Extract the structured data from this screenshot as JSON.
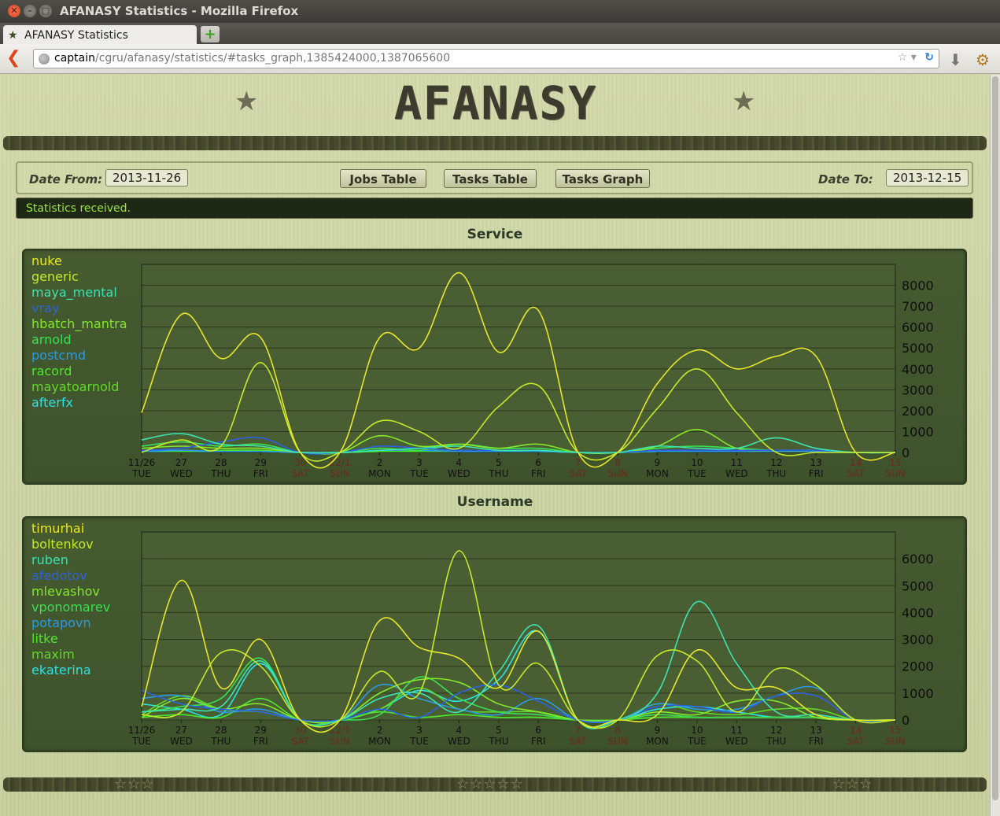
{
  "window": {
    "title": "AFANASY Statistics - Mozilla Firefox"
  },
  "tab": {
    "label": "AFANASY Statistics",
    "new_tab_symbol": "+"
  },
  "url": {
    "host": "captain",
    "path": "/cgru/afanasy/statistics/#tasks_graph,1385424000,1387065600"
  },
  "header": {
    "logo": "AFANASY"
  },
  "controls": {
    "date_from_label": "Date From:",
    "date_from_value": "2013-11-26",
    "date_to_label": "Date To:",
    "date_to_value": "2013-12-15",
    "jobs_table": "Jobs Table",
    "tasks_table": "Tasks Table",
    "tasks_graph": "Tasks Graph"
  },
  "status": "Statistics received.",
  "colors": {
    "weekday_label": "#111111",
    "weekend_label": "#6b2a1a",
    "grid": "#2a361d",
    "plot_bg": "#4a5e34"
  },
  "chart_data": [
    {
      "type": "line",
      "title": "Service",
      "x": [
        "11/26",
        "27",
        "28",
        "29",
        "30",
        "12/1",
        "2",
        "3",
        "4",
        "5",
        "6",
        "7",
        "8",
        "9",
        "10",
        "11",
        "12",
        "13",
        "14",
        "15"
      ],
      "x_days": [
        "TUE",
        "WED",
        "THU",
        "FRI",
        "SAT",
        "SUN",
        "MON",
        "TUE",
        "WED",
        "THU",
        "FRI",
        "SAT",
        "SUN",
        "MON",
        "TUE",
        "WED",
        "THU",
        "FRI",
        "SAT",
        "SUN"
      ],
      "weekend": [
        false,
        false,
        false,
        false,
        true,
        true,
        false,
        false,
        false,
        false,
        false,
        true,
        true,
        false,
        false,
        false,
        false,
        false,
        true,
        true
      ],
      "ylim": [
        0,
        9000
      ],
      "yticks": [
        0,
        1000,
        2000,
        3000,
        4000,
        5000,
        6000,
        7000,
        8000
      ],
      "series": [
        {
          "name": "nuke",
          "color": "#e6e62a",
          "values": [
            1900,
            6600,
            4500,
            5500,
            0,
            0,
            5500,
            5000,
            8600,
            4800,
            6800,
            0,
            0,
            3300,
            4900,
            4000,
            4600,
            4600,
            0,
            0
          ]
        },
        {
          "name": "generic",
          "color": "#c4e82a",
          "values": [
            0,
            600,
            300,
            4300,
            0,
            0,
            1500,
            1000,
            200,
            2200,
            3200,
            0,
            0,
            2100,
            4000,
            1900,
            0,
            0,
            0,
            0
          ]
        },
        {
          "name": "maya_mental",
          "color": "#3ce3b0",
          "values": [
            600,
            900,
            400,
            300,
            0,
            0,
            100,
            200,
            300,
            100,
            100,
            0,
            0,
            300,
            200,
            200,
            700,
            200,
            0,
            0
          ]
        },
        {
          "name": "vray",
          "color": "#2a62e3",
          "values": [
            100,
            200,
            500,
            700,
            0,
            0,
            300,
            200,
            100,
            100,
            100,
            0,
            0,
            100,
            100,
            100,
            100,
            100,
            0,
            0
          ]
        },
        {
          "name": "hbatch_mantra",
          "color": "#82e82a",
          "values": [
            200,
            300,
            200,
            200,
            0,
            0,
            800,
            300,
            400,
            200,
            400,
            0,
            0,
            300,
            1100,
            200,
            100,
            100,
            0,
            0
          ]
        },
        {
          "name": "arnold",
          "color": "#3ae052",
          "values": [
            300,
            500,
            300,
            400,
            0,
            0,
            200,
            100,
            400,
            200,
            200,
            0,
            0,
            200,
            300,
            200,
            100,
            100,
            0,
            0
          ]
        },
        {
          "name": "postcmd",
          "color": "#2a9ae3",
          "values": [
            50,
            100,
            50,
            50,
            0,
            0,
            100,
            100,
            50,
            50,
            50,
            0,
            0,
            50,
            50,
            50,
            50,
            50,
            0,
            0
          ]
        },
        {
          "name": "racord",
          "color": "#4ae82a",
          "values": [
            100,
            50,
            100,
            100,
            0,
            0,
            50,
            50,
            50,
            50,
            50,
            0,
            0,
            50,
            100,
            50,
            50,
            50,
            0,
            0
          ]
        },
        {
          "name": "mayatoarnold",
          "color": "#62d82a",
          "values": [
            50,
            100,
            50,
            100,
            0,
            0,
            50,
            100,
            100,
            50,
            100,
            0,
            0,
            50,
            50,
            50,
            50,
            50,
            0,
            0
          ]
        },
        {
          "name": "afterfx",
          "color": "#2ae3e3",
          "values": [
            50,
            50,
            50,
            50,
            0,
            0,
            50,
            50,
            50,
            50,
            50,
            0,
            0,
            50,
            50,
            50,
            50,
            50,
            0,
            0
          ]
        }
      ]
    },
    {
      "type": "line",
      "title": "Username",
      "x": [
        "11/26",
        "27",
        "28",
        "29",
        "30",
        "12/1",
        "2",
        "3",
        "4",
        "5",
        "6",
        "7",
        "8",
        "9",
        "10",
        "11",
        "12",
        "13",
        "14",
        "15"
      ],
      "x_days": [
        "TUE",
        "WED",
        "THU",
        "FRI",
        "SAT",
        "SUN",
        "MON",
        "TUE",
        "WED",
        "THU",
        "FRI",
        "SAT",
        "SUN",
        "MON",
        "TUE",
        "WED",
        "THU",
        "FRI",
        "SAT",
        "SUN"
      ],
      "weekend": [
        false,
        false,
        false,
        false,
        true,
        true,
        false,
        false,
        false,
        false,
        false,
        true,
        true,
        false,
        false,
        false,
        false,
        false,
        true,
        true
      ],
      "ylim": [
        0,
        7000
      ],
      "yticks": [
        0,
        1000,
        2000,
        3000,
        4000,
        5000,
        6000
      ],
      "series": [
        {
          "name": "timurhai",
          "color": "#e6e62a",
          "values": [
            500,
            5200,
            1200,
            3000,
            0,
            0,
            3700,
            2700,
            2300,
            1200,
            3300,
            0,
            0,
            200,
            2600,
            1200,
            1200,
            200,
            0,
            0
          ]
        },
        {
          "name": "boltenkov",
          "color": "#c4e82a",
          "values": [
            200,
            300,
            2500,
            2000,
            0,
            0,
            1800,
            1000,
            6300,
            1300,
            2100,
            0,
            0,
            2400,
            2200,
            300,
            1900,
            1300,
            0,
            0
          ]
        },
        {
          "name": "ruben",
          "color": "#3ce3b0",
          "values": [
            300,
            400,
            500,
            2200,
            0,
            0,
            800,
            1000,
            300,
            1800,
            3500,
            0,
            0,
            1000,
            4400,
            2100,
            300,
            200,
            0,
            0
          ]
        },
        {
          "name": "afedotov",
          "color": "#2a62e3",
          "values": [
            1100,
            600,
            400,
            300,
            0,
            0,
            400,
            100,
            1000,
            1300,
            700,
            0,
            0,
            500,
            500,
            300,
            900,
            900,
            0,
            0
          ]
        },
        {
          "name": "mlevashov",
          "color": "#82e82a",
          "values": [
            100,
            800,
            400,
            600,
            0,
            0,
            1000,
            1500,
            1400,
            600,
            300,
            0,
            0,
            300,
            200,
            700,
            700,
            100,
            0,
            0
          ]
        },
        {
          "name": "vponomarev",
          "color": "#3ae052",
          "values": [
            300,
            500,
            800,
            2300,
            0,
            0,
            200,
            1600,
            800,
            300,
            200,
            0,
            0,
            200,
            100,
            100,
            100,
            100,
            0,
            0
          ]
        },
        {
          "name": "potapovn",
          "color": "#2a9ae3",
          "values": [
            800,
            900,
            300,
            400,
            0,
            0,
            1300,
            800,
            400,
            200,
            800,
            0,
            0,
            600,
            400,
            400,
            900,
            1200,
            0,
            0
          ]
        },
        {
          "name": "litke",
          "color": "#4ae82a",
          "values": [
            100,
            200,
            100,
            800,
            0,
            0,
            300,
            100,
            200,
            100,
            100,
            0,
            0,
            100,
            100,
            100,
            100,
            100,
            0,
            0
          ]
        },
        {
          "name": "maxim",
          "color": "#62d82a",
          "values": [
            200,
            900,
            400,
            300,
            0,
            0,
            400,
            1200,
            400,
            300,
            300,
            0,
            0,
            600,
            300,
            200,
            400,
            400,
            0,
            0
          ]
        },
        {
          "name": "ekaterina",
          "color": "#2ae3e3",
          "values": [
            600,
            400,
            200,
            2100,
            0,
            0,
            400,
            1100,
            700,
            1500,
            3300,
            0,
            0,
            400,
            500,
            300,
            100,
            100,
            0,
            0
          ]
        }
      ]
    }
  ]
}
